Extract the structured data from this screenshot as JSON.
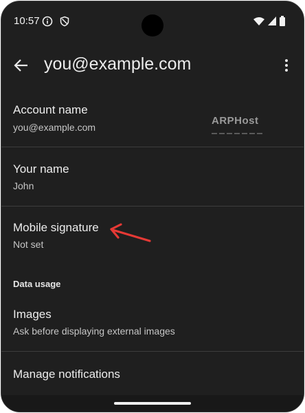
{
  "status_bar": {
    "time": "10:57",
    "icons": [
      "info-icon",
      "shield-icon",
      "wifi-icon",
      "signal-icon",
      "battery-icon"
    ]
  },
  "app_bar": {
    "title": "you@example.com",
    "back_icon": "back-arrow-icon",
    "menu_icon": "more-vert-icon"
  },
  "settings": {
    "account_name": {
      "title": "Account name",
      "value": "you@example.com"
    },
    "your_name": {
      "title": "Your name",
      "value": "John"
    },
    "mobile_signature": {
      "title": "Mobile signature",
      "value": "Not set"
    },
    "data_usage_header": "Data usage",
    "images": {
      "title": "Images",
      "value": "Ask before displaying external images"
    },
    "manage_notifications": {
      "title": "Manage notifications"
    }
  },
  "watermark": {
    "text": "ARPHost"
  },
  "colors": {
    "background": "#1f1f1f",
    "text_primary": "#ececec",
    "text_secondary": "#c6c6c6",
    "divider": "#3d3d3d",
    "annotation_arrow": "#e53935"
  }
}
